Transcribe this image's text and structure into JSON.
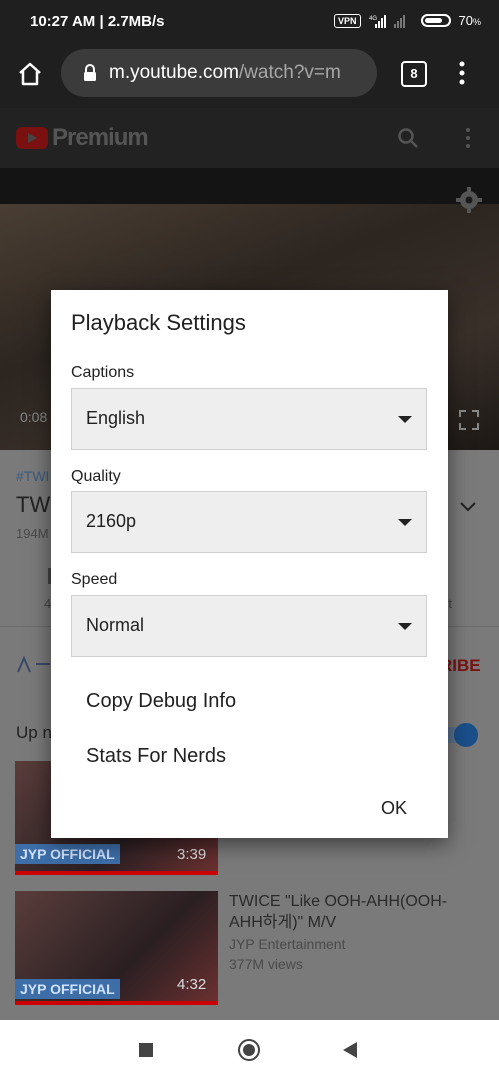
{
  "status_bar": {
    "time": "10:27 AM | 2.7MB/s",
    "vpn": "VPN",
    "battery": "70"
  },
  "browser": {
    "url_host": "m.youtube.com",
    "url_path": "/watch?v=m",
    "tab_count": "8"
  },
  "youtube": {
    "brand": "Premium",
    "video_time": "0:08",
    "title_tag": "#TWI",
    "title": "TW",
    "views": "194M",
    "count": "4",
    "side_text": "rt",
    "subscribe": "RIBE",
    "upnext": "Up n",
    "list": [
      {
        "channel_badge": "JYP OFFICIAL",
        "duration": "3:39"
      },
      {
        "title": "TWICE \"Like OOH-AHH(OOH-AHH하게)\" M/V",
        "channel": "JYP Entertainment",
        "views": "377M views",
        "channel_badge": "JYP OFFICIAL",
        "duration": "4:32"
      }
    ]
  },
  "dialog": {
    "title": "Playback Settings",
    "captions_label": "Captions",
    "captions_value": "English",
    "quality_label": "Quality",
    "quality_value": "2160p",
    "speed_label": "Speed",
    "speed_value": "Normal",
    "copy_debug": "Copy Debug Info",
    "stats": "Stats For Nerds",
    "ok": "OK"
  }
}
